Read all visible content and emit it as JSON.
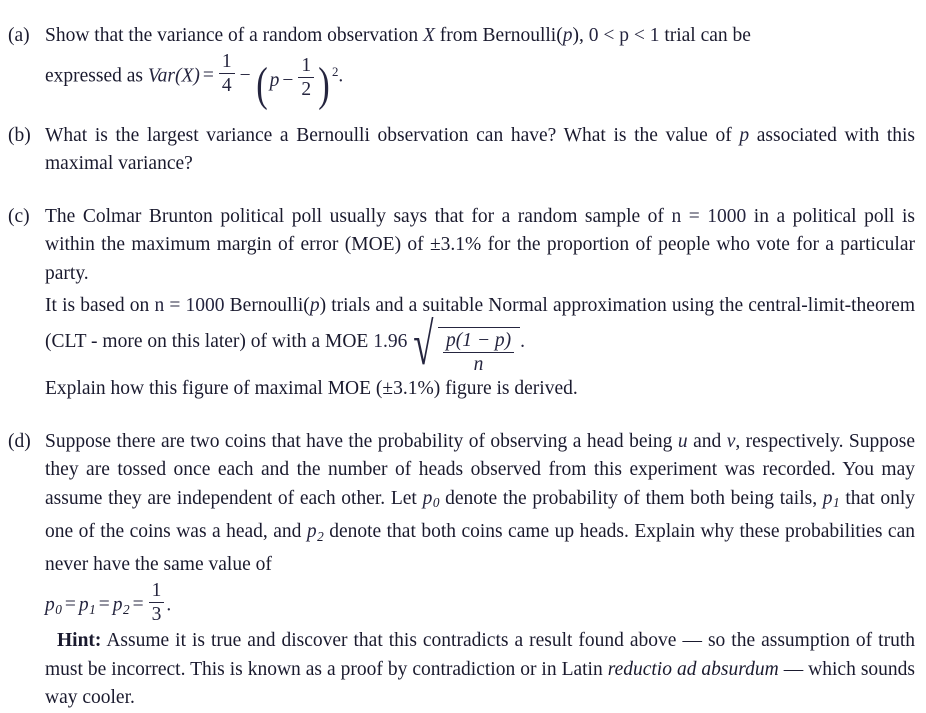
{
  "document": {
    "items": [
      {
        "label": "(a)",
        "text_before": "Show that the variance of a random observation ",
        "var_x": "X",
        "text_mid": " from Bernoulli(",
        "var_p": "p",
        "text_mid2": "), ",
        "range": "0 < p < 1",
        "text_after": " trial can be",
        "line2_prefix": "expressed as ",
        "formula_label": "Var(X)",
        "formula": {
          "equals": "=",
          "frac1_num": "1",
          "frac1_den": "4",
          "minus": "−",
          "inner_var": "p",
          "inner_minus": "−",
          "frac2_num": "1",
          "frac2_den": "2",
          "exponent": "2",
          "period": "."
        }
      },
      {
        "label": "(b)",
        "line1": "What is the largest variance a Bernoulli observation can have? What is the value of ",
        "var_p": "p",
        "line1_end": " associated",
        "line2": "with this maximal variance?"
      },
      {
        "label": "(c)",
        "para1_a": "The Colmar Brunton political poll usually says that for a random sample of ",
        "n_eq": "n = 1000",
        "para1_b": " in a political poll is within the maximum margin of error (MOE) of ±3.1% for the proportion of people who vote for a particular party.",
        "para2_a": "It is based on ",
        "n_eq2": "n = 1000",
        "para2_b": " Bernoulli(",
        "var_p": "p",
        "para2_c": ") trials and a suitable Normal approximation using the central-limit-theorem (CLT - more on this later) of with a MOE ",
        "moe_coefficient": "1.96",
        "radicand_num": "p(1 − p)",
        "radicand_den": "n",
        "period": ".",
        "para3": "Explain how this figure of maximal MOE (±3.1%) figure is derived."
      },
      {
        "label": "(d)",
        "para_a": "Suppose there are two coins that have the probability of observing a head being ",
        "var_u": "u",
        "para_b": " and ",
        "var_v": "v",
        "para_c": ", respectively. Suppose they are tossed once each and the number of heads observed from this experiment was recorded. You may assume they are independent of each other. Let ",
        "p0": "p",
        "p0_sub": "0",
        "para_d": " denote the probability of them both being tails, ",
        "p1": "p",
        "p1_sub": "1",
        "para_e": " that only one of the coins was a head, and ",
        "p2": "p",
        "p2_sub": "2",
        "para_f": " denote that both coins came up heads. Explain why these probabilities can never have the same value of",
        "equation": {
          "p0": "p",
          "p0_sub": "0",
          "eq1": "=",
          "p1": "p",
          "p1_sub": "1",
          "eq2": "=",
          "p2": "p",
          "p2_sub": "2",
          "eq3": "=",
          "frac_num": "1",
          "frac_den": "3",
          "period": "."
        },
        "hint_label": "Hint:",
        "hint_a": " Assume it is true and discover that this contradicts a result found above — so the assumption of truth must be incorrect. This is known as a proof by contradiction or in Latin ",
        "hint_italic1": "reductio ad absurdum",
        "hint_b": " — which sounds way cooler."
      }
    ]
  }
}
